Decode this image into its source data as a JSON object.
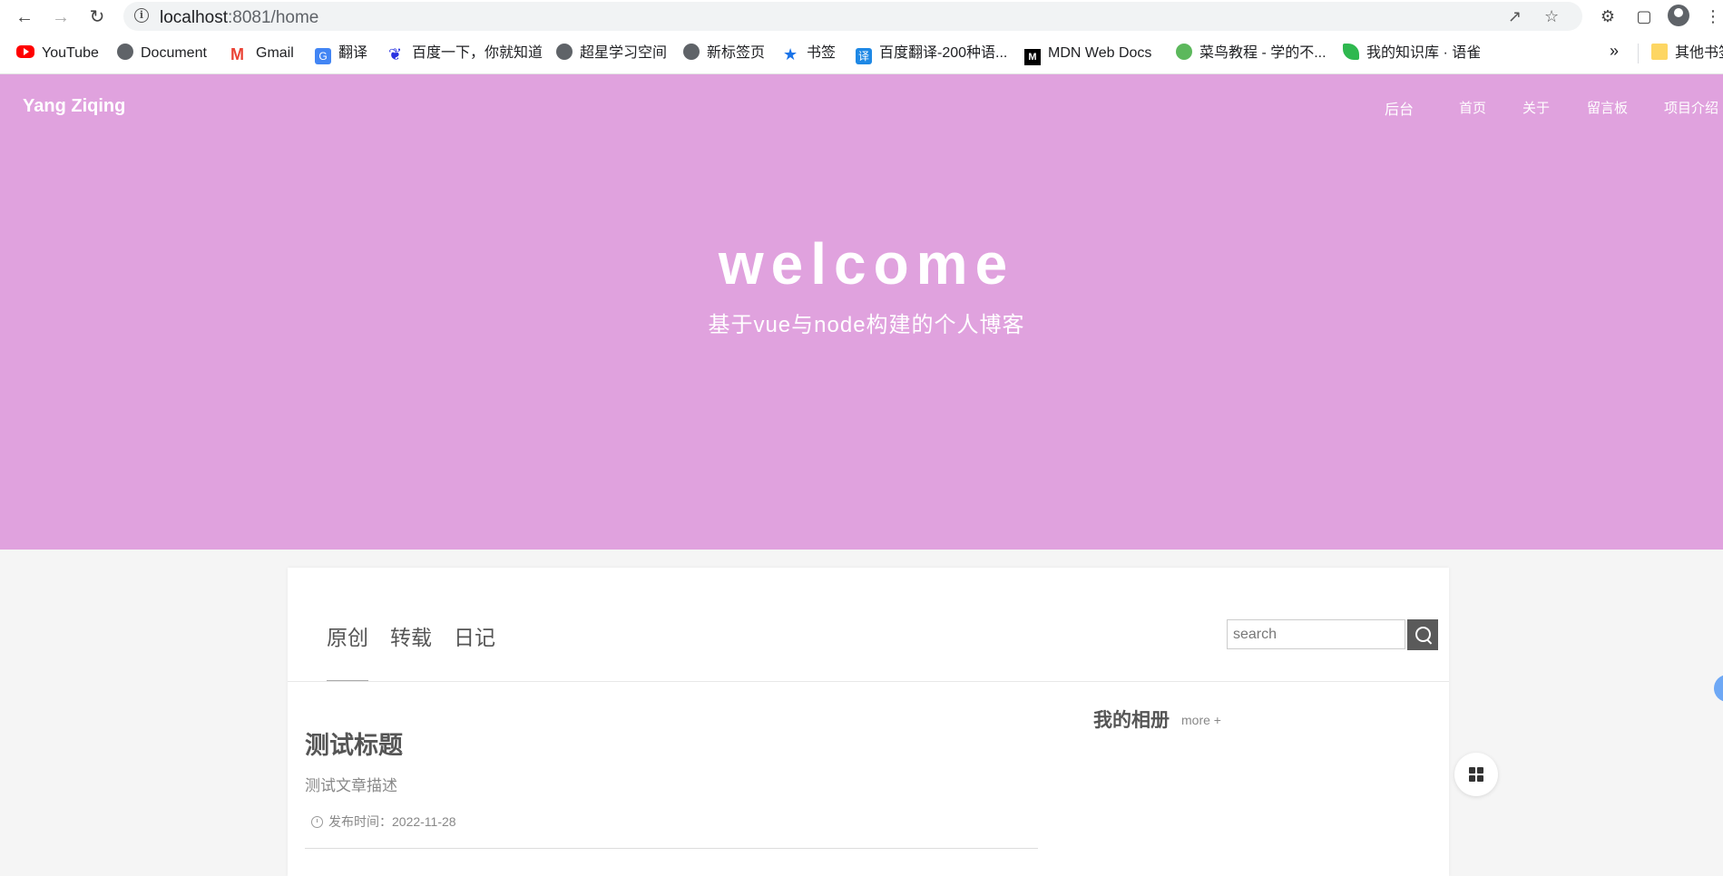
{
  "browser": {
    "url_host": "localhost",
    "url_path": ":8081/home",
    "bookmarks": [
      {
        "label": "YouTube",
        "icon": "youtube-icon"
      },
      {
        "label": "Document",
        "icon": "globe-icon"
      },
      {
        "label": "Gmail",
        "icon": "gmail-icon"
      },
      {
        "label": "翻译",
        "icon": "translate-icon"
      },
      {
        "label": "百度一下，你就知道",
        "icon": "baidu-icon"
      },
      {
        "label": "超星学习空间",
        "icon": "globe-icon"
      },
      {
        "label": "新标签页",
        "icon": "globe-icon"
      },
      {
        "label": "书签",
        "icon": "star-icon"
      },
      {
        "label": "百度翻译-200种语...",
        "icon": "baidu-translate-icon"
      },
      {
        "label": "MDN Web Docs",
        "icon": "mdn-icon"
      },
      {
        "label": "菜鸟教程 - 学的不...",
        "icon": "runoob-icon"
      },
      {
        "label": "我的知识库 · 语雀",
        "icon": "yuque-icon"
      }
    ],
    "more_bookmarks": "»",
    "other_bookmarks": "其他书签",
    "icon_glyphs": {
      "favicon_yt": "",
      "gm": "M",
      "tr": "G",
      "bd": "❦",
      "star": "★",
      "fy": "译",
      "mdn": "M"
    }
  },
  "site": {
    "brand": "Yang Ziqing",
    "nav": {
      "admin": "后台",
      "home": "首页",
      "about": "关于",
      "guestbook": "留言板",
      "projects": "项目介绍"
    },
    "hero_title": "welcome",
    "hero_subtitle": "基于vue与node构建的个人博客"
  },
  "content": {
    "tabs": [
      "原创",
      "转载",
      "日记"
    ],
    "search_placeholder": "search",
    "post": {
      "title": "测试标题",
      "description": "测试文章描述",
      "meta": "发布时间：2022-11-28"
    },
    "album": {
      "title": "我的相册",
      "more": "more +"
    }
  },
  "colors": {
    "hero_bg": "#e0a2de",
    "page_bg": "#f5f5f5",
    "search_btn": "#5a5a5a"
  }
}
